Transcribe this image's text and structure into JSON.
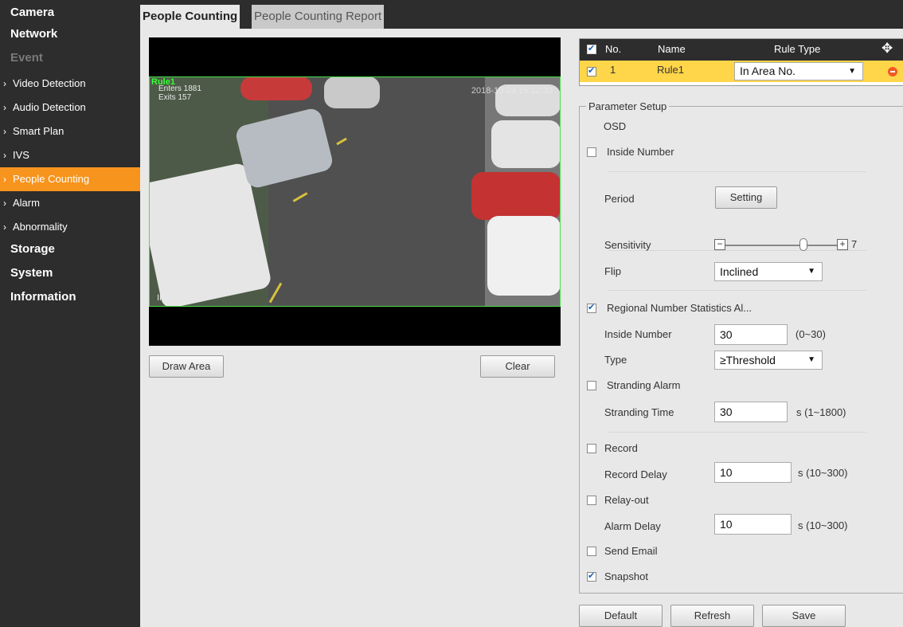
{
  "sidebar": {
    "categories": {
      "camera": "Camera",
      "network": "Network",
      "event": "Event",
      "storage": "Storage",
      "system": "System",
      "information": "Information"
    },
    "event_items": [
      "Video Detection",
      "Audio Detection",
      "Smart Plan",
      "IVS",
      "People Counting",
      "Alarm",
      "Abnormality"
    ],
    "active_item": "People Counting"
  },
  "tabs": {
    "active": "People Counting",
    "inactive": "People Counting Report"
  },
  "video": {
    "rule_label": "Rule1",
    "enters": "Enters 1881",
    "exits": "Exits 157",
    "timestamp": "2018-10-23 15:12:30",
    "channel_label": "IPC"
  },
  "video_buttons": {
    "draw_area": "Draw Area",
    "clear": "Clear"
  },
  "rules_table": {
    "headers": {
      "no": "No.",
      "name": "Name",
      "rule_type": "Rule Type"
    },
    "rows": [
      {
        "checked": true,
        "no": "1",
        "name": "Rule1",
        "rule_type": "In Area No."
      }
    ]
  },
  "params": {
    "legend": "Parameter Setup",
    "osd": "OSD",
    "inside_number_cb": "Inside Number",
    "period_label": "Period",
    "setting_button": "Setting",
    "sensitivity_label": "Sensitivity",
    "sensitivity_value": "7",
    "sensitivity_level": 0.7,
    "flip_label": "Flip",
    "flip_value": "Inclined",
    "regional_cb": "Regional Number Statistics Al...",
    "inside_number_label": "Inside Number",
    "inside_number_value": "30",
    "inside_number_range": "(0~30)",
    "type_label": "Type",
    "type_value": "≥Threshold",
    "stranding_alarm_cb": "Stranding Alarm",
    "stranding_time_label": "Stranding Time",
    "stranding_time_value": "30",
    "stranding_time_range": "s (1~1800)",
    "record_cb": "Record",
    "record_delay_label": "Record Delay",
    "record_delay_value": "10",
    "record_delay_range": "s (10~300)",
    "relay_out_cb": "Relay-out",
    "alarm_delay_label": "Alarm Delay",
    "alarm_delay_value": "10",
    "alarm_delay_range": "s (10~300)",
    "send_email_cb": "Send Email",
    "snapshot_cb": "Snapshot"
  },
  "footer": {
    "default": "Default",
    "refresh": "Refresh",
    "save": "Save"
  }
}
